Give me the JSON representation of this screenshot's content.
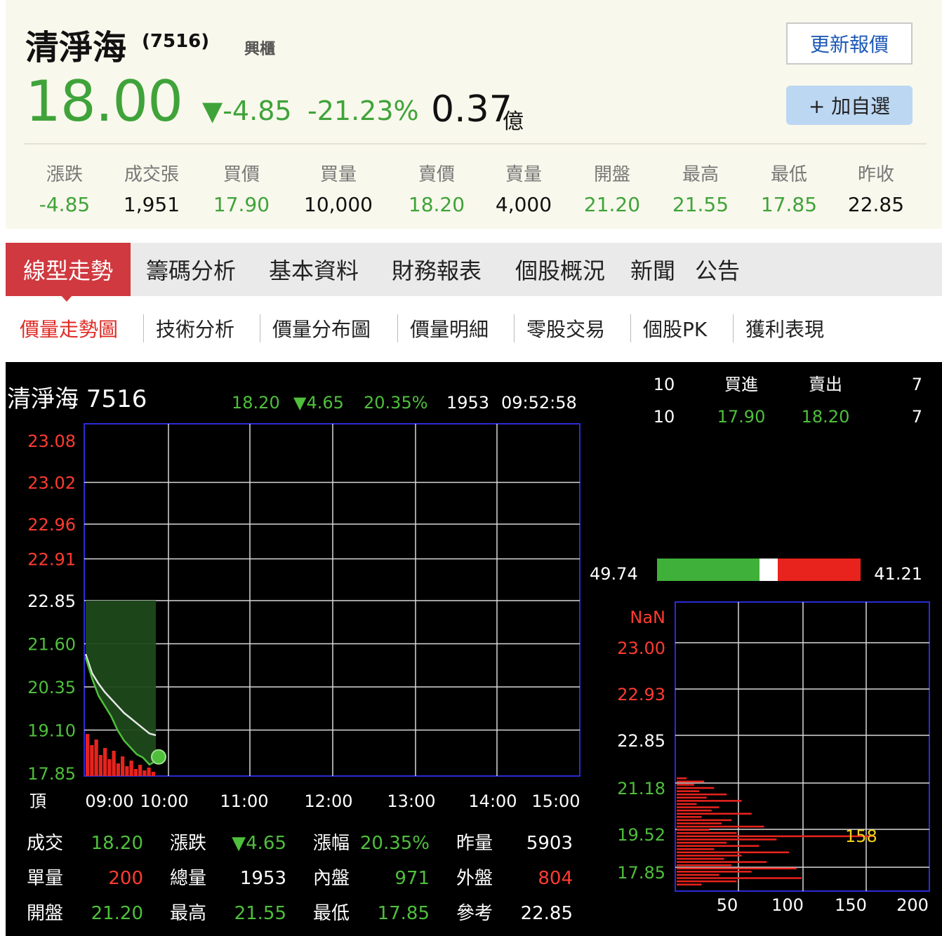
{
  "quote": {
    "name": "清淨海",
    "code": "(7516)",
    "market": "興櫃",
    "price": "18.00",
    "change": "▼-4.85",
    "change_pct": "-21.23%",
    "amount": "0.37",
    "amount_unit": "億",
    "refresh_label": "更新報價",
    "add_label": "+ 加自選",
    "stats": [
      {
        "label": "漲跌",
        "value": "-4.85",
        "color": "green"
      },
      {
        "label": "成交張",
        "value": "1,951",
        "color": "black"
      },
      {
        "label": "買價",
        "value": "17.90",
        "color": "green"
      },
      {
        "label": "買量",
        "value": "10,000",
        "color": "black"
      },
      {
        "label": "賣價",
        "value": "18.20",
        "color": "green"
      },
      {
        "label": "賣量",
        "value": "4,000",
        "color": "black"
      },
      {
        "label": "開盤",
        "value": "21.20",
        "color": "green"
      },
      {
        "label": "最高",
        "value": "21.55",
        "color": "green"
      },
      {
        "label": "最低",
        "value": "17.85",
        "color": "green"
      },
      {
        "label": "昨收",
        "value": "22.85",
        "color": "black"
      }
    ]
  },
  "tabs": [
    "線型走勢",
    "籌碼分析",
    "基本資料",
    "財務報表",
    "個股概況",
    "新聞",
    "公告"
  ],
  "subtabs": [
    "價量走勢圖",
    "技術分析",
    "價量分布圖",
    "價量明細",
    "零股交易",
    "個股PK",
    "獲利表現"
  ],
  "panel": {
    "title": "清淨海 7516",
    "last_price": "18.20",
    "last_change": "▼4.65",
    "last_pct": "20.35%",
    "volume": "1953",
    "time": "09:52:58",
    "corner_label": "頂",
    "order_book": {
      "headers": [
        "10",
        "買進",
        "賣出",
        "7"
      ],
      "row": [
        "10",
        "17.90",
        "18.20",
        "7"
      ]
    },
    "ratio": {
      "left": "49.74",
      "right": "41.21"
    },
    "bottom_stats": [
      {
        "label": "成交",
        "value": "18.20",
        "color": "green"
      },
      {
        "label": "漲跌",
        "value": "▼4.65",
        "color": "green"
      },
      {
        "label": "漲幅",
        "value": "20.35%",
        "color": "green"
      },
      {
        "label": "昨量",
        "value": "5903",
        "color": "white"
      },
      {
        "label": "單量",
        "value": "200",
        "color": "red"
      },
      {
        "label": "總量",
        "value": "1953",
        "color": "white"
      },
      {
        "label": "內盤",
        "value": "971",
        "color": "green"
      },
      {
        "label": "外盤",
        "value": "804",
        "color": "red"
      },
      {
        "label": "開盤",
        "value": "21.20",
        "color": "green"
      },
      {
        "label": "最高",
        "value": "21.55",
        "color": "green"
      },
      {
        "label": "最低",
        "value": "17.85",
        "color": "green"
      },
      {
        "label": "參考",
        "value": "22.85",
        "color": "white"
      }
    ]
  },
  "chart_data": [
    {
      "type": "line",
      "y_tick_labels": [
        {
          "label": "23.08",
          "color": "red"
        },
        {
          "label": "23.02",
          "color": "red"
        },
        {
          "label": "22.96",
          "color": "red"
        },
        {
          "label": "22.91",
          "color": "red"
        },
        {
          "label": "22.85",
          "color": "white"
        },
        {
          "label": "21.60",
          "color": "green"
        },
        {
          "label": "20.35",
          "color": "green"
        },
        {
          "label": "19.10",
          "color": "green"
        },
        {
          "label": "17.85",
          "color": "green"
        }
      ],
      "x_tick_labels": [
        "09:00",
        "10:00",
        "11:00",
        "12:00",
        "13:00",
        "14:00",
        "15:00"
      ],
      "series": [
        {
          "x": [
            "09:00",
            "09:05",
            "09:10",
            "09:15",
            "09:20",
            "09:25",
            "09:30",
            "09:35",
            "09:40",
            "09:45",
            "09:50",
            "09:53"
          ],
          "values": [
            21.2,
            20.6,
            20.1,
            19.8,
            19.5,
            19.1,
            18.8,
            18.6,
            18.4,
            18.3,
            18.1,
            18.2
          ]
        },
        {
          "x": [
            "09:00",
            "09:05",
            "09:10",
            "09:15",
            "09:20",
            "09:25",
            "09:30",
            "09:35",
            "09:40",
            "09:45",
            "09:50",
            "09:53"
          ],
          "values": [
            21.3,
            20.75,
            20.45,
            20.2,
            20.0,
            19.8,
            19.6,
            19.45,
            19.3,
            19.15,
            19.0,
            18.95
          ]
        }
      ],
      "reference": 22.85,
      "ylim": [
        17.85,
        23.08
      ]
    },
    {
      "type": "bar",
      "orientation": "horizontal",
      "y_tick_labels": [
        {
          "label": "NaN",
          "color": "red"
        },
        {
          "label": "23.00",
          "color": "red"
        },
        {
          "label": "22.93",
          "color": "red"
        },
        {
          "label": "22.85",
          "color": "white"
        },
        {
          "label": "21.18",
          "color": "green"
        },
        {
          "label": "19.52",
          "color": "green"
        },
        {
          "label": "17.85",
          "color": "green"
        }
      ],
      "x_tick_labels": [
        "50",
        "100",
        "150",
        "200"
      ],
      "max_label": "158",
      "xlim": [
        0,
        200
      ],
      "values": [
        8,
        22,
        14,
        30,
        18,
        40,
        24,
        52,
        16,
        34,
        28,
        60,
        20,
        44,
        36,
        70,
        26,
        48,
        158,
        80,
        40,
        66,
        30,
        90,
        52,
        38,
        72,
        44,
        96,
        60,
        34,
        100,
        48,
        20
      ]
    }
  ]
}
